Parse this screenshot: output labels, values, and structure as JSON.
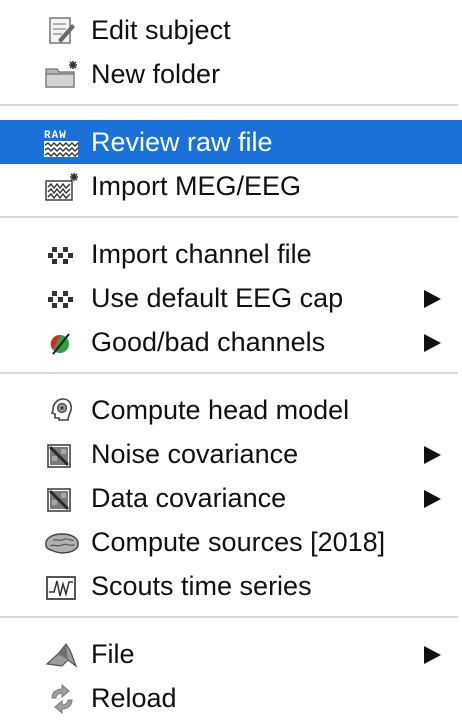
{
  "menu": {
    "items": [
      {
        "label": "Edit subject",
        "icon": "edit-document-icon",
        "submenu": false
      },
      {
        "label": "New folder",
        "icon": "new-folder-icon",
        "submenu": false
      },
      {
        "label": "Review raw file",
        "icon": "raw-file-icon",
        "submenu": false,
        "highlighted": true
      },
      {
        "label": "Import MEG/EEG",
        "icon": "import-data-icon",
        "submenu": false
      },
      {
        "label": "Import channel file",
        "icon": "channel-dots-icon",
        "submenu": false
      },
      {
        "label": "Use default EEG cap",
        "icon": "channel-dots-icon",
        "submenu": true
      },
      {
        "label": "Good/bad channels",
        "icon": "good-bad-channels-icon",
        "submenu": true
      },
      {
        "label": "Compute head model",
        "icon": "head-model-icon",
        "submenu": false
      },
      {
        "label": "Noise covariance",
        "icon": "covariance-icon",
        "submenu": true
      },
      {
        "label": "Data covariance",
        "icon": "covariance-icon",
        "submenu": true
      },
      {
        "label": "Compute sources [2018]",
        "icon": "brain-sources-icon",
        "submenu": false
      },
      {
        "label": "Scouts time series",
        "icon": "scouts-timeseries-icon",
        "submenu": false
      },
      {
        "label": "File",
        "icon": "file-menu-icon",
        "submenu": true
      },
      {
        "label": "Reload",
        "icon": "reload-icon",
        "submenu": false
      }
    ]
  },
  "colors": {
    "highlight": "#1a72d9",
    "highlight_text": "#ffffff",
    "text": "#111111",
    "separator": "#d6d6d6"
  }
}
